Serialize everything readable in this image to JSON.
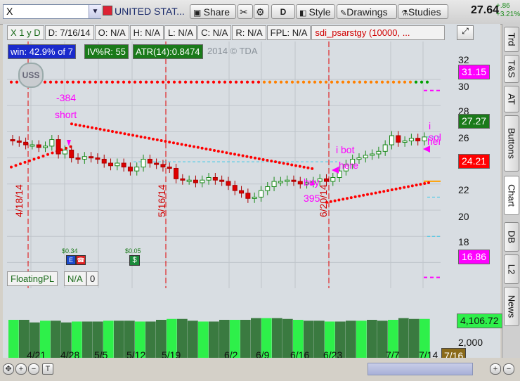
{
  "toolbar": {
    "symbol": "X",
    "company": "UNITED STAT...",
    "buttons": {
      "share": "Share",
      "draw_mode": "D",
      "style": "Style",
      "drawings": "Drawings",
      "studies": "Studies"
    },
    "last_price": "27.64",
    "net_change": "+.86",
    "net_change_pct": "+3.21%"
  },
  "right_tabs": [
    "Trd",
    "T&S",
    "AT",
    "Buttons",
    "Chart",
    "DB",
    "L2",
    "News"
  ],
  "header": {
    "period": "X 1 y D",
    "date": "D: 7/16/14",
    "open": "O: N/A",
    "high": "H: N/A",
    "low": "L: N/A",
    "close": "C: N/A",
    "range": "R: N/A",
    "fpl": "FPL: N/A",
    "strategy": "sdi_psarstgy (10000, ..."
  },
  "stats": {
    "win": "win: 42.9% of 7",
    "ivr": "IV%R: 55",
    "atr": "ATR(14):0.8474",
    "watermark": "2014 © TDA"
  },
  "price_axis": {
    "ticks": [
      "32",
      "30",
      "28",
      "26",
      "24",
      "22",
      "20",
      "18"
    ],
    "badges": {
      "top": "31.15",
      "last": "27.27",
      "psar": "24.21",
      "low": "16.86"
    }
  },
  "annotations": {
    "sell_value": "-384",
    "sell_label": "short",
    "buy_label": "buy",
    "buy_value": "395",
    "ibot1": "i bot",
    "ibot2": "here",
    "isold1": "i sold",
    "isold2": "here",
    "vline_dates": [
      "4/18/14",
      "5/16/14",
      "6/20/14"
    ],
    "div1": "$0.34",
    "div2": "$0.05"
  },
  "lower": {
    "label": "FloatingPL",
    "value": "N/A",
    "zero": "0",
    "badge": "4,106.72",
    "ticks": [
      "2,000",
      "0"
    ]
  },
  "date_axis": [
    "4/21",
    "4/28",
    "5/5",
    "5/12",
    "5/19",
    "6/2",
    "6/9",
    "6/16",
    "6/23",
    "7/7",
    "7/14"
  ],
  "date_badge": "7/16",
  "colors": {
    "up": "#2ecc40",
    "down": "#cc0000",
    "psar_red": "#ff0000",
    "psar_green": "#00a000",
    "magenta": "#ff00ff"
  },
  "chart_data": {
    "type": "line",
    "title": "",
    "xlabel": "",
    "ylabel": "",
    "ylim": [
      15,
      33
    ],
    "candle_close_series": [
      {
        "date": "4/14",
        "close": 27.2
      },
      {
        "date": "4/21",
        "close": 26.7
      },
      {
        "date": "4/28",
        "close": 25.9
      },
      {
        "date": "5/5",
        "close": 25.6
      },
      {
        "date": "5/12",
        "close": 25.8
      },
      {
        "date": "5/19",
        "close": 24.2
      },
      {
        "date": "6/2",
        "close": 23.1
      },
      {
        "date": "6/9",
        "close": 24.0
      },
      {
        "date": "6/16",
        "close": 24.2
      },
      {
        "date": "6/23",
        "close": 25.8
      },
      {
        "date": "7/7",
        "close": 27.2
      },
      {
        "date": "7/14",
        "close": 27.6
      }
    ]
  }
}
